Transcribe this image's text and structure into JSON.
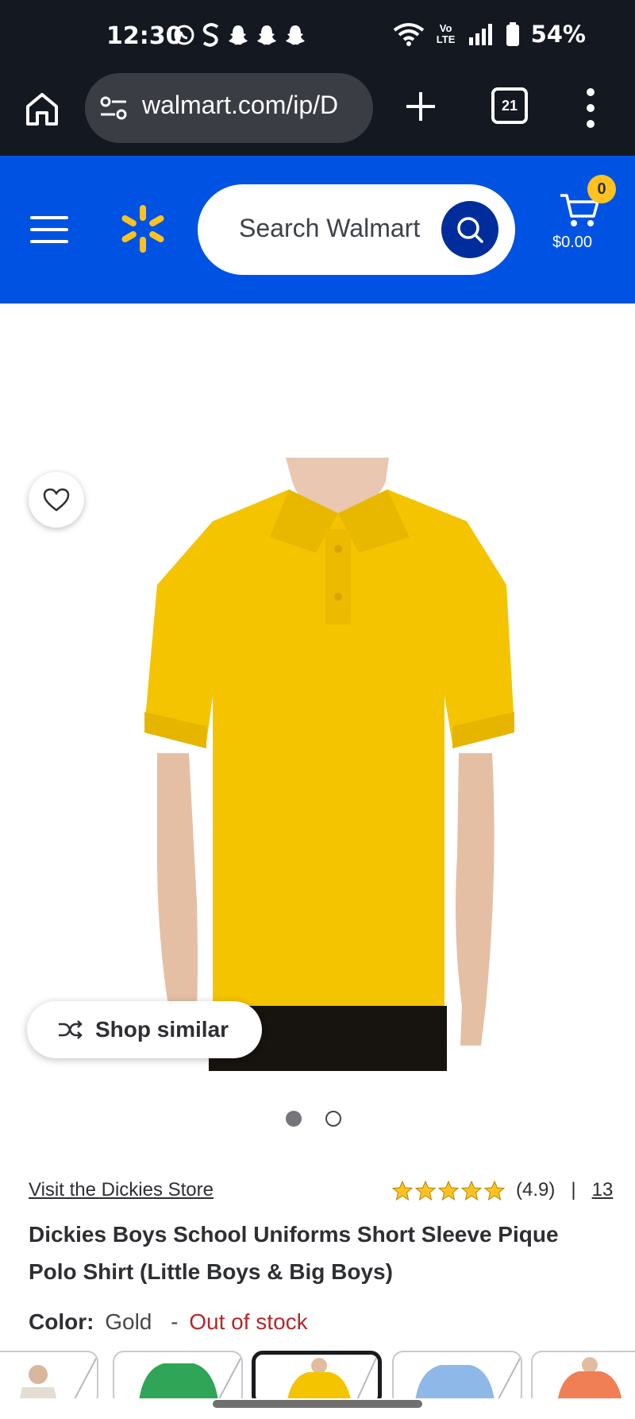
{
  "status_bar": {
    "time": "12:30",
    "left_icons": [
      "whatsapp-icon",
      "skype-icon",
      "snapchat-icon",
      "snapchat-icon",
      "snapchat-icon"
    ],
    "right_icons": [
      "wifi-icon",
      "volte-icon",
      "signal-icon",
      "battery-icon"
    ],
    "volte_label": "Vo LTE",
    "battery": "54%"
  },
  "browser": {
    "url": "walmart.com/ip/D",
    "tab_count": "21"
  },
  "header": {
    "search_placeholder": "Search Walmart",
    "cart_count": "0",
    "cart_total": "$0.00",
    "brand_blue": "#0053e2",
    "spark_yellow": "#ffc220"
  },
  "product": {
    "image_color": "#f5c400",
    "shop_similar_label": "Shop similar",
    "carousel": {
      "current": 1,
      "total": 2
    },
    "store_link": "Visit the Dickies Store",
    "rating": {
      "stars": 5,
      "value": "(4.9)",
      "separator": "|",
      "count": "13"
    },
    "title": "Dickies Boys School Uniforms Short Sleeve Pique Polo Shirt (Little Boys & Big Boys)",
    "color_label": "Color:",
    "color_value": "Gold",
    "color_separator": "-",
    "stock_status": "Out of stock",
    "swatches": [
      {
        "color": "#e9e4dd",
        "selected": false
      },
      {
        "color": "#2fa657",
        "selected": false
      },
      {
        "color": "#f5c400",
        "selected": true
      },
      {
        "color": "#8db8e8",
        "selected": false
      },
      {
        "color": "#f07f55",
        "selected": false
      }
    ]
  }
}
